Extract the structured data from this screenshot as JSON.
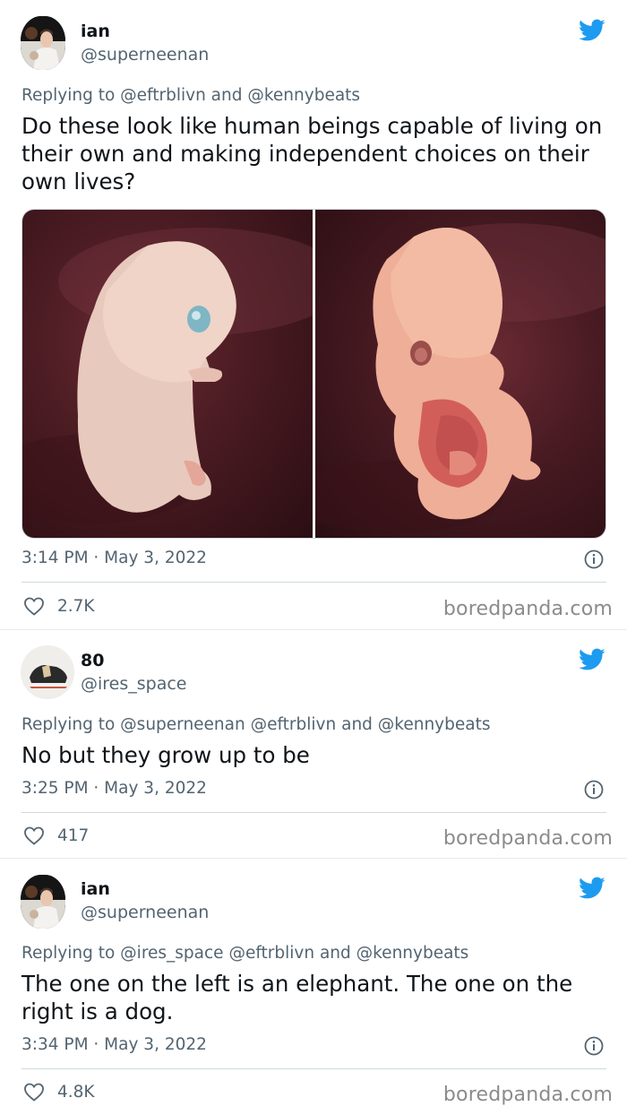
{
  "tweets": [
    {
      "name": "ian",
      "handle": "@superneenan",
      "reply": "Replying to @eftrblivn and @kennybeats",
      "text": "Do these look like human beings capable of living on their own and making independent choices on their own lives?",
      "time": "3:14 PM · May 3, 2022",
      "likes": "2.7K",
      "watermark": "boredpanda.com"
    },
    {
      "name": "80",
      "handle": "@ires_space",
      "reply": "Replying to @superneenan @eftrblivn and @kennybeats",
      "text": "No but they grow up to be",
      "time": "3:25 PM · May 3, 2022",
      "likes": "417",
      "watermark": "boredpanda.com"
    },
    {
      "name": "ian",
      "handle": "@superneenan",
      "reply": "Replying to @ires_space @eftrblivn and @kennybeats",
      "text": "The one on the left is an elephant. The one on the right is a dog.",
      "time": "3:34 PM · May 3, 2022",
      "likes": "4.8K",
      "watermark": "boredpanda.com"
    }
  ],
  "icons": {
    "twitter": "twitter-bird-icon",
    "info": "info-icon",
    "like": "heart-icon"
  },
  "colors": {
    "twitter_blue": "#1d9bf0",
    "secondary_text": "#536471",
    "primary_text": "#0f1419"
  }
}
